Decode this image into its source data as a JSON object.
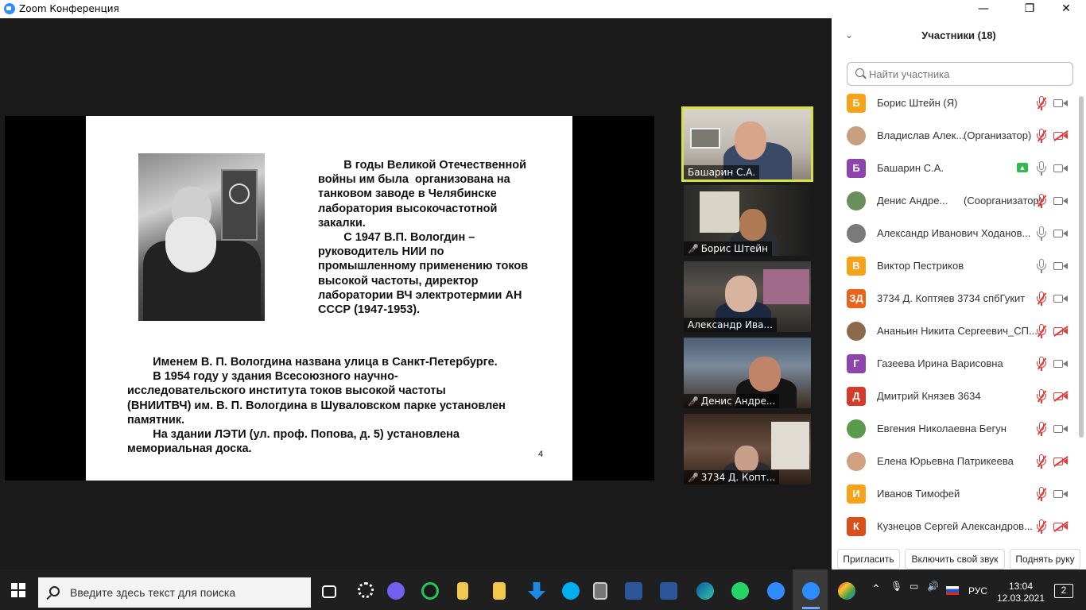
{
  "window": {
    "title": "Zoom Конференция",
    "controls": {
      "minimize": "—",
      "maximize": "❐",
      "close": "✕"
    }
  },
  "slide": {
    "paragraph1": "        В годы Великой Отечественной\nвойны им была  организована на\nтанковом заводе в Челябинске\nлаборатория высокочастотной\nзакалки.\n        С 1947 В.П. Вологдин –\nруководитель НИИ по\nпромышленному применению токов\nвысокой частоты, директор\nлаборатории ВЧ электротермии АН\nСССР (1947-1953).",
    "paragraph2": "        Именем В. П. Вологдина названа улица в Санкт-Петербурге.\n        В 1954 году у здания Всесоюзного научно-\nисследовательского института токов высокой частоты\n(ВНИИТВЧ) им. В. П. Вологдина в Шуваловском парке установлен\nпамятник.\n        На здании ЛЭТИ (ул. проф. Попова, д. 5) установлена\nмемориальная доска.",
    "page_number": "4"
  },
  "video_thumbs": [
    {
      "name": "Башарин С.А.",
      "muted": false,
      "active": true
    },
    {
      "name": "Борис Штейн",
      "muted": true,
      "active": false
    },
    {
      "name": "Александр Ива...",
      "muted": false,
      "active": false
    },
    {
      "name": "Денис Андре...",
      "muted": true,
      "active": false
    },
    {
      "name": "3734 Д. Копт...",
      "muted": true,
      "active": false
    }
  ],
  "participants_panel": {
    "title": "Участники (18)",
    "search_placeholder": "Найти участника",
    "participants": [
      {
        "initial": "Б",
        "avatar_color": "#f7a21b",
        "name": "Борис Штейн (Я)",
        "role": "",
        "mic": "off",
        "cam": "on"
      },
      {
        "initial": "",
        "avatar_color": "#c8a080",
        "name": "Владислав Алек...",
        "role": "(Организатор)",
        "mic": "off",
        "cam": "off"
      },
      {
        "initial": "Б",
        "avatar_color": "#8e44ad",
        "name": "Башарин С.А.",
        "role": "",
        "mic": "on",
        "cam": "on",
        "sharing": true
      },
      {
        "initial": "",
        "avatar_color": "#6b8e5a",
        "name": "Денис Андре...",
        "role": "(Соорганизатор)",
        "mic": "off",
        "cam": "on"
      },
      {
        "initial": "",
        "avatar_color": "#7a7a7a",
        "name": "Александр Иванович Ходанов...",
        "role": "",
        "mic": "on",
        "cam": "on"
      },
      {
        "initial": "В",
        "avatar_color": "#f7a21b",
        "name": "Виктор Пестриков",
        "role": "",
        "mic": "on",
        "cam": "on"
      },
      {
        "initial": "ЗД",
        "avatar_color": "#e8641b",
        "name": "3734 Д. Коптяев 3734 спбГукит",
        "role": "",
        "mic": "off",
        "cam": "on"
      },
      {
        "initial": "",
        "avatar_color": "#8a6a4a",
        "name": "Ананьин Никита Сергеевич_СП...",
        "role": "",
        "mic": "off",
        "cam": "off"
      },
      {
        "initial": "Г",
        "avatar_color": "#8e44ad",
        "name": "Газеева Ирина Варисовна",
        "role": "",
        "mic": "off",
        "cam": "on"
      },
      {
        "initial": "Д",
        "avatar_color": "#d63a2a",
        "name": "Дмитрий Князев 3634",
        "role": "",
        "mic": "off",
        "cam": "off"
      },
      {
        "initial": "",
        "avatar_color": "#5a9a4a",
        "name": "Евгения Николаевна Бегун",
        "role": "",
        "mic": "off",
        "cam": "on"
      },
      {
        "initial": "",
        "avatar_color": "#d0a080",
        "name": "Елена Юрьевна Патрикеева",
        "role": "",
        "mic": "off",
        "cam": "off"
      },
      {
        "initial": "И",
        "avatar_color": "#f7a21b",
        "name": "Иванов Тимофей",
        "role": "",
        "mic": "off",
        "cam": "on"
      },
      {
        "initial": "К",
        "avatar_color": "#d9501b",
        "name": "Кузнецов Сергей Александров...",
        "role": "",
        "mic": "off",
        "cam": "off"
      }
    ],
    "buttons": {
      "invite": "Пригласить",
      "unmute": "Включить свой звук",
      "raise_hand": "Поднять руку"
    }
  },
  "taskbar": {
    "search_placeholder": "Введите здесь текст для поиска",
    "language": "РУС",
    "time": "13:04",
    "date": "12.03.2021",
    "notifications": "2"
  }
}
